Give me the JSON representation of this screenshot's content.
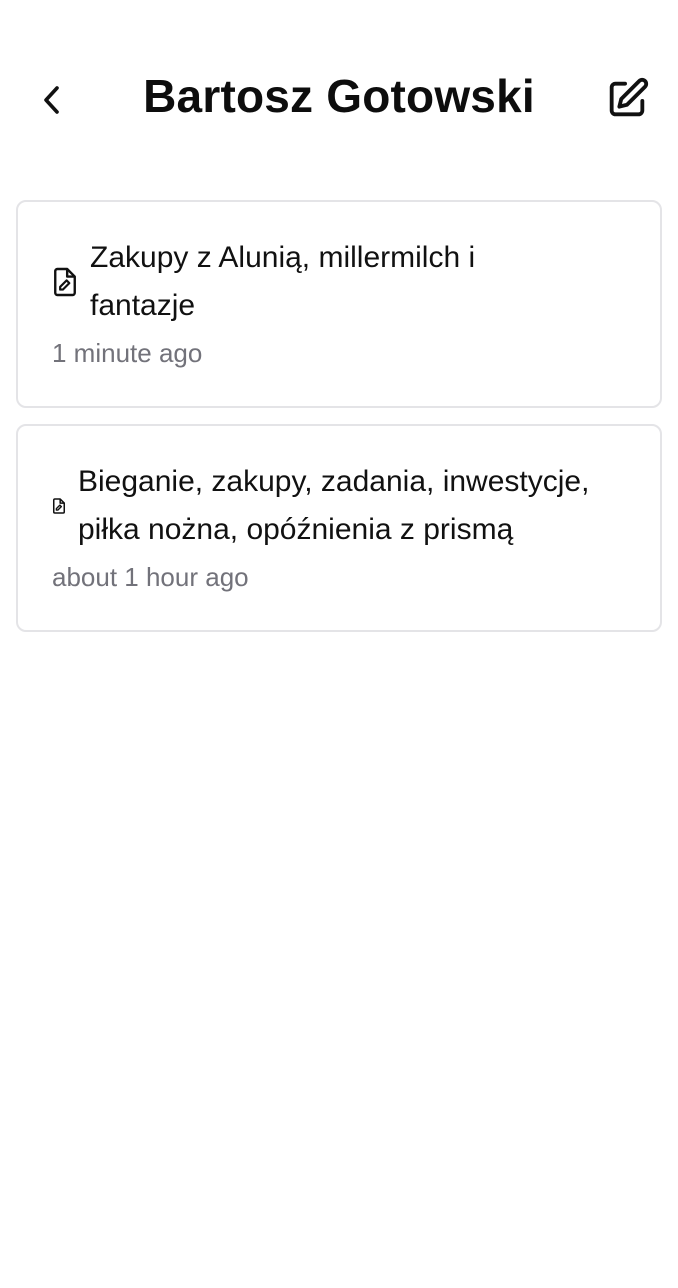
{
  "header": {
    "title": "Bartosz Gotowski",
    "back_icon": "chevron-left-icon",
    "edit_icon": "edit-square-icon"
  },
  "notes": [
    {
      "title": "Zakupy z Alunią, millermilch i fantazje",
      "time": "1 minute ago",
      "icon": "file-edit-icon"
    },
    {
      "title": "Bieganie, zakupy, zadania, inwestycje, piłka nożna, opóźnienia z prismą",
      "time": "about 1 hour ago",
      "icon": "file-edit-icon"
    }
  ],
  "colors": {
    "text": "#111111",
    "muted": "#72727a",
    "border": "#e4e4e7"
  }
}
